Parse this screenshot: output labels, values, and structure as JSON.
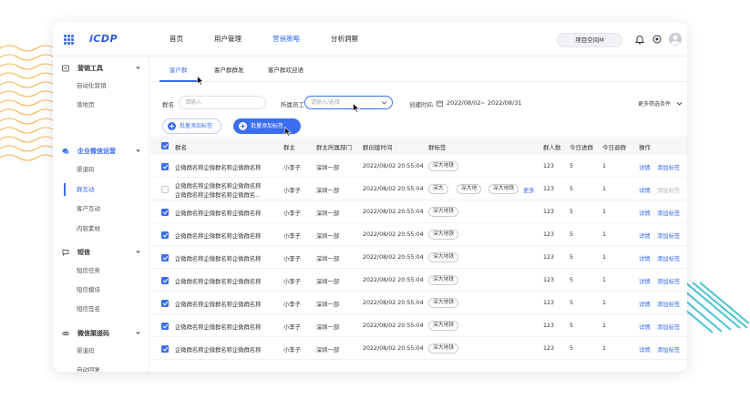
{
  "app": {
    "logo": "iCDP"
  },
  "topnav": {
    "items": [
      {
        "label": "首页",
        "active": false
      },
      {
        "label": "用户管理",
        "active": false
      },
      {
        "label": "营销策略",
        "active": true
      },
      {
        "label": "分析洞察",
        "active": false
      }
    ],
    "workspace": "项目空间M",
    "icons": [
      "grid-icon",
      "bell-icon",
      "target-icon",
      "avatar"
    ]
  },
  "sidebar": {
    "groups": [
      {
        "label": "营销工具",
        "icon": "tool-icon",
        "items": [
          "自动化营销",
          "落地页"
        ]
      },
      {
        "label": "企业微信运营",
        "icon": "wechat-icon",
        "active": true,
        "items": [
          "渠道码",
          "群互动",
          "客户互动",
          "内容素材"
        ],
        "active_item": "群互动"
      },
      {
        "label": "短信",
        "icon": "sms-icon",
        "items": [
          "短信任务",
          "短信模块",
          "短信签名"
        ]
      },
      {
        "label": "微信渠道码",
        "icon": "link-icon",
        "items": [
          "渠道码",
          "自动回复"
        ]
      }
    ]
  },
  "tabs": [
    {
      "label": "客户群",
      "active": true
    },
    {
      "label": "客户群群发",
      "active": false
    },
    {
      "label": "客户群欢迎语",
      "active": false
    }
  ],
  "filters": {
    "group_name_label": "群名",
    "group_name_placeholder": "请输入",
    "staff_label": "所属员工",
    "staff_placeholder": "请输入/选择",
    "date_label": "创建时间",
    "date_start": "2022/08/02",
    "date_sep": "~",
    "date_end": "2022/08/31",
    "more_label": "更多筛选条件"
  },
  "actions": {
    "add_tag": "批量添加标签",
    "batch_add_tag": "批量添加标签"
  },
  "table": {
    "columns": [
      "群名",
      "群主",
      "群主所属部门",
      "群创建时间",
      "群标签",
      "群人数",
      "今日进群",
      "今日退群",
      "操作"
    ],
    "rows": [
      {
        "checked": true,
        "name": "企微群名称企微群名称企微群名称",
        "name2": "",
        "owner": "小李子",
        "dept": "深圳一部",
        "created": "2022/08/02 20:55:04",
        "tags": [
          "深大地铁"
        ],
        "more": "",
        "members": "123",
        "joined": "5",
        "left": "1",
        "op_detail": "详情",
        "op_tag": "添加标签",
        "op_tag_disabled": false
      },
      {
        "checked": false,
        "name": "企微群名称企微群名称企微群名称",
        "name2": "企微群名称企微群名称企微群名...",
        "owner": "小李子",
        "dept": "深圳一部",
        "created": "2022/08/02 20:55:04",
        "tags": [
          "深大",
          "深大地",
          "深大地铁"
        ],
        "more": "更多",
        "members": "123",
        "joined": "5",
        "left": "1",
        "op_detail": "详情",
        "op_tag": "添加标签",
        "op_tag_disabled": true
      },
      {
        "checked": true,
        "name": "企微群名称企微群名称企微群名称",
        "name2": "",
        "owner": "小李子",
        "dept": "深圳一部",
        "created": "2022/08/02 20:55:04",
        "tags": [
          "深大地铁"
        ],
        "more": "",
        "members": "123",
        "joined": "5",
        "left": "1",
        "op_detail": "详情",
        "op_tag": "添加标签",
        "op_tag_disabled": false
      },
      {
        "checked": true,
        "name": "企微群名称企微群名称企微群名称",
        "name2": "",
        "owner": "小李子",
        "dept": "深圳一部",
        "created": "2022/08/02 20:55:04",
        "tags": [
          "深大地铁"
        ],
        "more": "",
        "members": "123",
        "joined": "5",
        "left": "1",
        "op_detail": "详情",
        "op_tag": "添加标签",
        "op_tag_disabled": false
      },
      {
        "checked": true,
        "name": "企微群名称企微群名称企微群名称",
        "name2": "",
        "owner": "小李子",
        "dept": "深圳一部",
        "created": "2022/08/02 20:55:04",
        "tags": [
          "深大地铁"
        ],
        "more": "",
        "members": "123",
        "joined": "5",
        "left": "1",
        "op_detail": "详情",
        "op_tag": "添加标签",
        "op_tag_disabled": false
      },
      {
        "checked": true,
        "name": "企微群名称企微群名称企微群名称",
        "name2": "",
        "owner": "小李子",
        "dept": "深圳一部",
        "created": "2022/08/02 20:55:04",
        "tags": [
          "深大地铁"
        ],
        "more": "",
        "members": "123",
        "joined": "5",
        "left": "1",
        "op_detail": "详情",
        "op_tag": "添加标签",
        "op_tag_disabled": false
      },
      {
        "checked": true,
        "name": "企微群名称企微群名称企微群名称",
        "name2": "",
        "owner": "小李子",
        "dept": "深圳一部",
        "created": "2022/08/02 20:55:04",
        "tags": [
          "深大地铁"
        ],
        "more": "",
        "members": "123",
        "joined": "5",
        "left": "1",
        "op_detail": "详情",
        "op_tag": "添加标签",
        "op_tag_disabled": false
      },
      {
        "checked": true,
        "name": "企微群名称企微群名称企微群名称",
        "name2": "",
        "owner": "小李子",
        "dept": "深圳一部",
        "created": "2022/08/02 20:55:04",
        "tags": [
          "深大地铁"
        ],
        "more": "",
        "members": "123",
        "joined": "5",
        "left": "1",
        "op_detail": "详情",
        "op_tag": "添加标签",
        "op_tag_disabled": false
      },
      {
        "checked": true,
        "name": "企微群名称企微群名称企微群名称",
        "name2": "",
        "owner": "小李子",
        "dept": "深圳一部",
        "created": "2022/08/02 20:55:04",
        "tags": [
          "深大地铁"
        ],
        "more": "",
        "members": "123",
        "joined": "5",
        "left": "1",
        "op_detail": "详情",
        "op_tag": "添加标签",
        "op_tag_disabled": false
      }
    ]
  },
  "colors": {
    "accent": "#3a6df0",
    "decor_orange": "#f5b24a",
    "decor_teal": "#4cc2cf"
  }
}
